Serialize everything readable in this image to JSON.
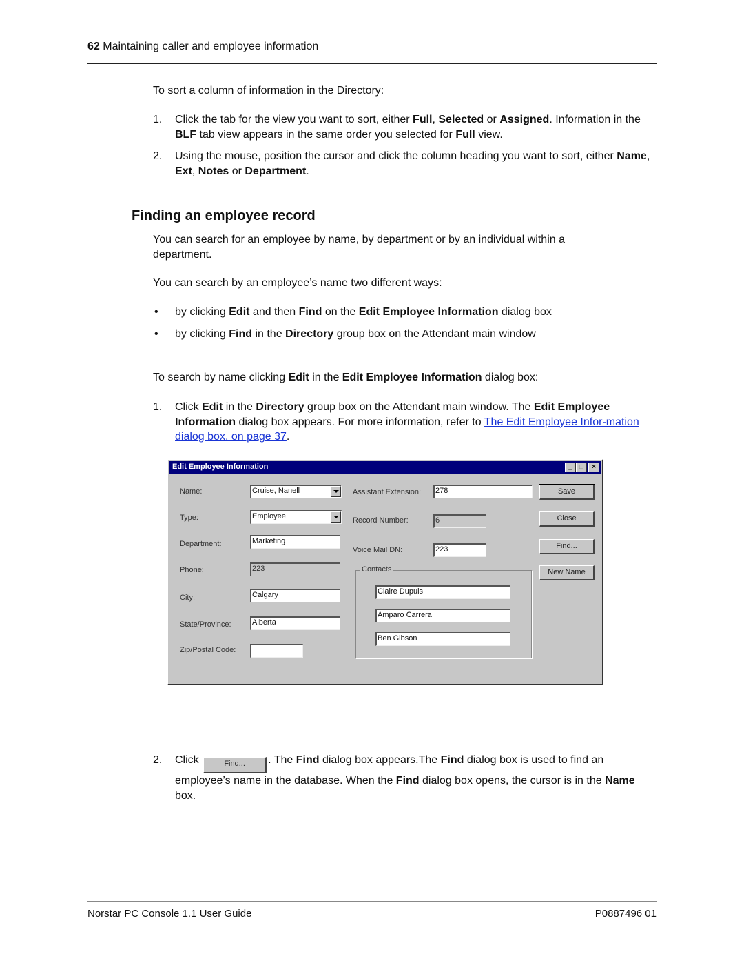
{
  "header": {
    "page_number": "62",
    "chapter_title": "Maintaining caller and employee information"
  },
  "sort_section": {
    "intro": "To sort a column of information in the Directory:",
    "steps": [
      {
        "num": "1.",
        "t1": "Click the tab for the view you want to sort, either ",
        "b1": "Full",
        "t2": ", ",
        "b2": "Selected",
        "t3": " or ",
        "b3": "Assigned",
        "t4": ". Information in the ",
        "b4": "BLF",
        "t5": " tab view appears in the same order you selected for ",
        "b5": "Full",
        "t6": " view."
      },
      {
        "num": "2.",
        "t1": "Using the mouse, position the cursor and click the column heading you want to sort, either ",
        "b1": "Name",
        "t2": ", ",
        "b2": "Ext",
        "t3": ", ",
        "b3": "Notes",
        "t4": " or ",
        "b4": "Department",
        "t5": "."
      }
    ]
  },
  "finding_section": {
    "heading": "Finding an employee record",
    "para1": "You can search for an employee by name, by department or by an individual within a department.",
    "para2": "You can search by an employee’s name two different ways:",
    "bullets": [
      {
        "t1": "by clicking ",
        "b1": "Edit",
        "t2": " and then ",
        "b2": "Find",
        "t3": " on the ",
        "b3": "Edit Employee Information",
        "t4": " dialog box"
      },
      {
        "t1": "by clicking ",
        "b1": "Find",
        "t2": " in the ",
        "b2": "Directory",
        "t3": " group box on the Attendant main window"
      }
    ],
    "bullet_glyph": "•",
    "intro2": {
      "t1": "To search by name clicking ",
      "b1": "Edit",
      "t2": " in the ",
      "b2": "Edit Employee Information",
      "t3": " dialog box:"
    },
    "step1": {
      "num": "1.",
      "t1": "Click ",
      "b1": "Edit",
      "t2": " in the ",
      "b2": "Directory",
      "t3": " group box on the Attendant main window. The ",
      "b3": "Edit Employee Information",
      "t4": " dialog box appears. For more information, refer to ",
      "link": "The Edit Employee Infor-mation dialog box. on page 37",
      "t5": "."
    },
    "step2": {
      "num": "2.",
      "t1": "Click",
      "button_label": "Find...",
      "t2": ". The ",
      "b1": "Find",
      "t3": " dialog box appears.The ",
      "b2": "Find",
      "t4": " dialog box is used to find an employee’s name in the database. When the ",
      "b3": "Find",
      "t5": " dialog box opens, the cursor is in the ",
      "b4": "Name",
      "t6": " box."
    }
  },
  "dialog": {
    "title": "Edit Employee Information",
    "title_buttons": {
      "minimize": "_",
      "maximize": "□",
      "close": "×"
    },
    "fields": {
      "name": {
        "label": "Name:",
        "value": "Cruise, Nanell"
      },
      "type": {
        "label": "Type:",
        "value": "Employee"
      },
      "department": {
        "label": "Department:",
        "value": "Marketing"
      },
      "phone": {
        "label": "Phone:",
        "value": "223"
      },
      "city": {
        "label": "City:",
        "value": "Calgary"
      },
      "state": {
        "label": "State/Province:",
        "value": "Alberta"
      },
      "zip": {
        "label": "Zip/Postal Code:",
        "value": ""
      },
      "assistant_ext": {
        "label": "Assistant Extension:",
        "value": "278"
      },
      "record_number": {
        "label": "Record Number:",
        "value": "6"
      },
      "voice_mail_dn": {
        "label": "Voice Mail DN:",
        "value": "223"
      }
    },
    "contacts": {
      "label": "Contacts",
      "values": [
        "Claire Dupuis",
        "Amparo Carrera",
        "Ben Gibson"
      ]
    },
    "buttons": {
      "save": "Save",
      "close": "Close",
      "find": "Find...",
      "new_name": "New Name"
    }
  },
  "footer": {
    "left": "Norstar PC Console 1.1 User Guide",
    "right": "P0887496 01"
  },
  "colors": {
    "link": "#1a35d6",
    "titlebar": "#00007b",
    "dialog_face": "#c7c7c7"
  }
}
